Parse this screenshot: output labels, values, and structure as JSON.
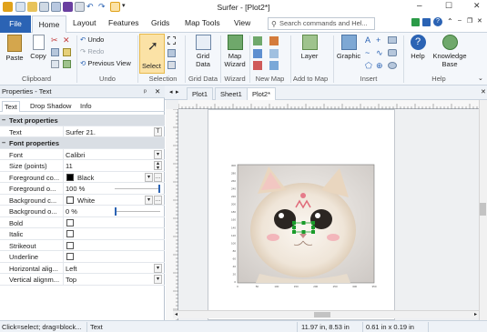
{
  "app": {
    "title": "Surfer - [Plot2*]",
    "win_min": "–",
    "win_max": "☐",
    "win_close": "✕"
  },
  "ribbon_tabs": {
    "file": "File",
    "home": "Home",
    "layout": "Layout",
    "features": "Features",
    "grids": "Grids",
    "map_tools": "Map Tools",
    "view": "View"
  },
  "search": {
    "placeholder": "Search commands and Hel..."
  },
  "ribbon": {
    "paste": "Paste",
    "copy": "Copy",
    "clipboard": "Clipboard",
    "undo": "Undo",
    "redo": "Redo",
    "previous_view": "Previous View",
    "undo_group": "Undo",
    "select": "Select",
    "selection": "Selection",
    "grid_data": "Grid Data",
    "grid_data_group": "Grid Data",
    "map_wizard": "Map Wizard",
    "wizard": "Wizard",
    "new_map": "New Map",
    "layer": "Layer",
    "add_to_map": "Add to Map",
    "graphic": "Graphic",
    "insert": "Insert",
    "help": "Help",
    "knowledge_base": "Knowledge Base",
    "help_group": "Help"
  },
  "doc_tabs": [
    "Plot1",
    "Sheet1",
    "Plot2*"
  ],
  "props": {
    "header": "Properties - Text",
    "pin": "ᵖ",
    "close": "✕",
    "tabs": [
      "Text",
      "Drop Shadow",
      "Info"
    ],
    "sections": {
      "text_properties": "Text properties",
      "font_properties": "Font properties"
    },
    "rows": {
      "text": {
        "label": "Text",
        "value": "Surfer 21."
      },
      "font": {
        "label": "Font",
        "value": "Calibri"
      },
      "size": {
        "label": "Size (points)",
        "value": "11"
      },
      "fg_color": {
        "label": "Foreground co...",
        "value": "Black"
      },
      "fg_opacity": {
        "label": "Foreground o...",
        "value": "100 %"
      },
      "bg_color": {
        "label": "Background c...",
        "value": "White"
      },
      "bg_opacity": {
        "label": "Background o...",
        "value": "0 %"
      },
      "bold": {
        "label": "Bold"
      },
      "italic": {
        "label": "Italic"
      },
      "strikeout": {
        "label": "Strikeout"
      },
      "underline": {
        "label": "Underline"
      },
      "h_align": {
        "label": "Horizontal alig...",
        "value": "Left"
      },
      "v_align": {
        "label": "Vertical alignm...",
        "value": "Top"
      }
    },
    "colors": {
      "foreground": "#000000",
      "background": "#ffffff"
    },
    "opacity_levels": {
      "foreground": 1.0,
      "background": 0.0
    }
  },
  "map": {
    "y_ticks": [
      "300",
      "280",
      "260",
      "240",
      "220",
      "200",
      "180",
      "160",
      "140",
      "120",
      "100",
      "80",
      "60",
      "40",
      "20",
      "0"
    ],
    "x_ticks": [
      "0",
      "50",
      "100",
      "150",
      "200",
      "250",
      "300",
      "350"
    ]
  },
  "status": {
    "hint": "Click=select; drag=block...",
    "object": "Text",
    "coords": "11.97 in, 8.53 in",
    "size": "0.61 in x 0.19 in"
  },
  "colors": {
    "accent": "#2b63b4",
    "select_highlight": "#fbe2a6"
  }
}
